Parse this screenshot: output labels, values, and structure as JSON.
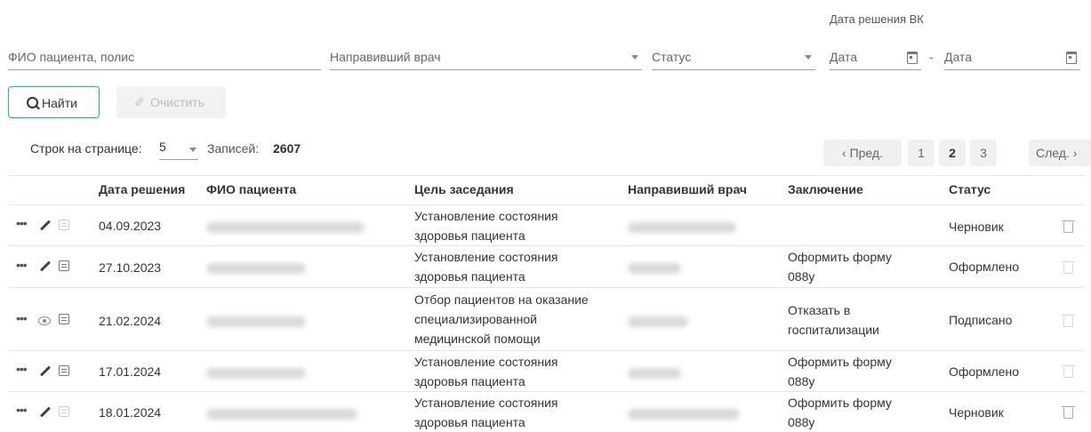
{
  "filters": {
    "patient_placeholder": "ФИО пациента, полис",
    "doctor_placeholder": "Направивший врач",
    "status_placeholder": "Статус",
    "date_group_label": "Дата решения ВК",
    "date_from_placeholder": "Дата",
    "date_separator": "-",
    "date_to_placeholder": "Дата"
  },
  "actions": {
    "find_label": "Найти",
    "clear_label": "Очистить"
  },
  "pagination": {
    "rows_label": "Строк на странице:",
    "rows_value": "5",
    "records_label": "Записей:",
    "records_value": "2607",
    "prev_label": "‹ Пред.",
    "pages": [
      "1",
      "2",
      "3"
    ],
    "current_page": "2",
    "next_label": "След. ›"
  },
  "table": {
    "headers": [
      "Дата решения",
      "ФИО пациента",
      "Цель заседания",
      "Направивший врач",
      "Заключение",
      "Статус"
    ],
    "rows": [
      {
        "date": "04.09.2023",
        "goal": [
          "Установление состояния",
          "здоровья пациента"
        ],
        "conclusion": [],
        "status": "Черновик",
        "view_icon": "pencil-icon"
      },
      {
        "date": "27.10.2023",
        "goal": [
          "Установление состояния",
          "здоровья пациента"
        ],
        "conclusion": [
          "Оформить форму",
          "088у"
        ],
        "status": "Оформлено",
        "view_icon": "pencil-icon"
      },
      {
        "date": "21.02.2024",
        "goal": [
          "Отбор пациентов на оказание",
          "специализированной",
          "медицинской помощи"
        ],
        "conclusion": [
          "Отказать в",
          "госпитализации"
        ],
        "status": "Подписано",
        "view_icon": "eye-icon"
      },
      {
        "date": "17.01.2024",
        "goal": [
          "Установление состояния",
          "здоровья пациента"
        ],
        "conclusion": [
          "Оформить форму",
          "088у"
        ],
        "status": "Оформлено",
        "view_icon": "pencil-icon"
      },
      {
        "date": "18.01.2024",
        "goal": [
          "Установление состояния",
          "здоровья пациента"
        ],
        "conclusion": [
          "Оформить форму",
          "088у"
        ],
        "status": "Черновик",
        "view_icon": "pencil-icon"
      }
    ]
  }
}
